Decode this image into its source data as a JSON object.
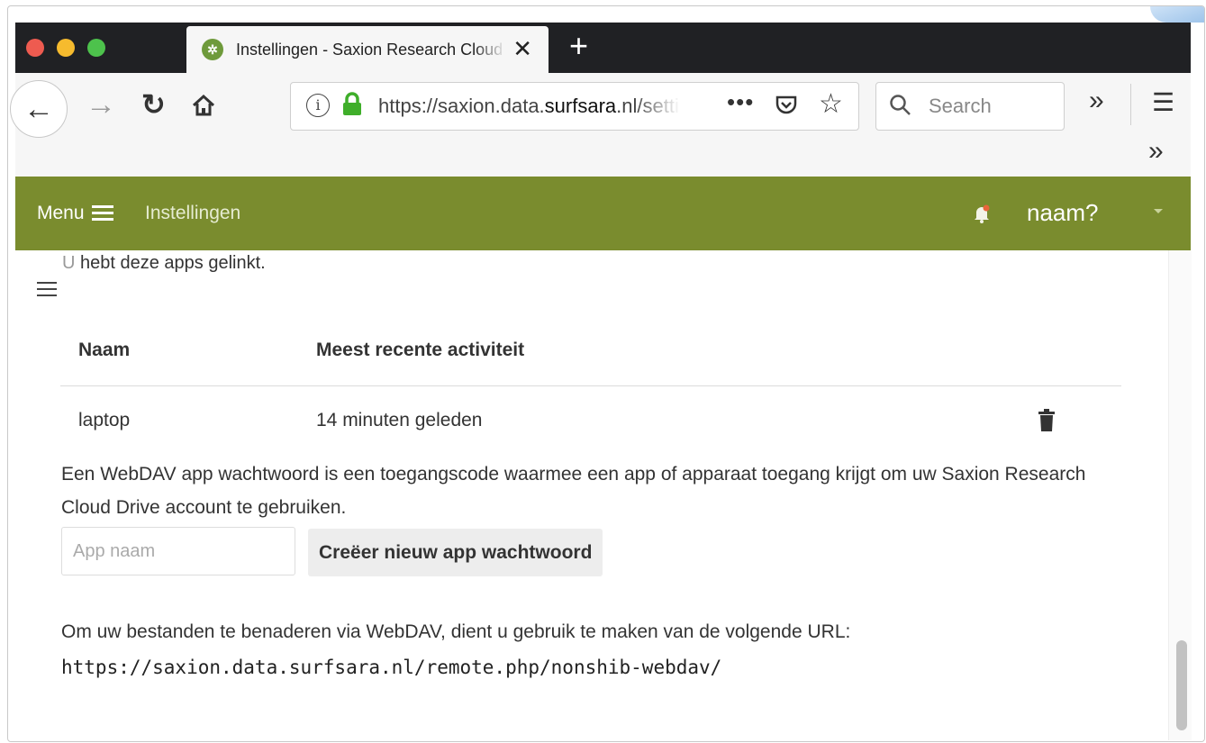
{
  "browser": {
    "tab_title": "Instellingen - Saxion Research Cloud Drive",
    "tab_close": "✕",
    "new_tab": "+",
    "url_prefix": "https://saxion.data.",
    "url_domain": "surfsara",
    "url_suffix": ".nl/settings/personal",
    "url_more": "•••",
    "search_placeholder": "Search",
    "overflow_glyph": "»",
    "menu_glyph": "☰"
  },
  "appbar": {
    "menu_label": "Menu",
    "breadcrumb": "Instellingen",
    "user_name": "naam?"
  },
  "content": {
    "intro_u": "U",
    "intro_rest": " hebt deze apps gelinkt.",
    "table_headers": [
      "Naam",
      "Meest recente activiteit"
    ],
    "rows": [
      {
        "name": "laptop",
        "activity": "14 minuten geleden"
      }
    ],
    "description": "Een WebDAV app wachtwoord is een toegangscode waarmee een app of apparaat toegang krijgt om uw Saxion Research Cloud Drive account te gebruiken.",
    "app_name_placeholder": "App naam",
    "create_button": "Creëer nieuw app wachtwoord",
    "webdav_text": "Om uw bestanden te benaderen via WebDAV, dient u gebruik te maken van de volgende URL:",
    "webdav_url": "https://saxion.data.surfsara.nl/remote.php/nonshib-webdav/"
  },
  "colors": {
    "appbar": "#7a8c2e",
    "tabbar": "#202124"
  }
}
